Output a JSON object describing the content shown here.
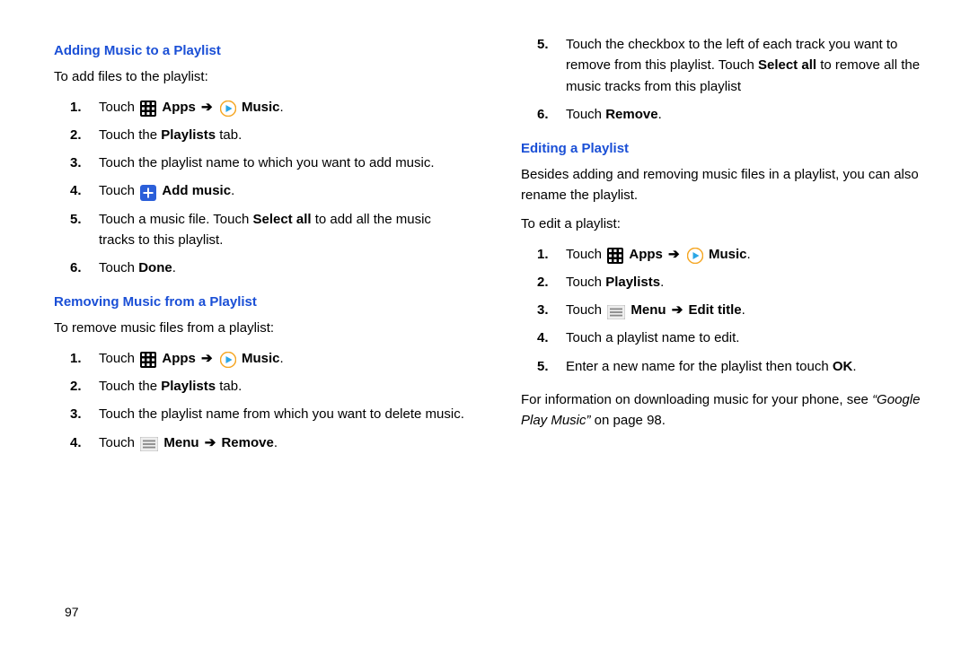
{
  "page_number": "97",
  "arrow_glyph": "➔",
  "left": {
    "heading1": "Adding Music to a Playlist",
    "intro1": "To add files to the playlist:",
    "steps1": [
      {
        "n": "1.",
        "pre": "Touch ",
        "icon": "apps",
        "b1": "Apps",
        "arrow": true,
        "icon2": "music",
        "b2": "Music",
        "post": "."
      },
      {
        "n": "2.",
        "pre": "Touch the ",
        "b1": "Playlists",
        "post": " tab."
      },
      {
        "n": "3.",
        "pre": "Touch the playlist name to which you want to add music."
      },
      {
        "n": "4.",
        "pre": "Touch ",
        "icon": "plus",
        "b1": "Add music",
        "post": "."
      },
      {
        "n": "5.",
        "pre": "Touch a music file. Touch ",
        "b1": "Select all",
        "post": " to add all the music tracks to this playlist."
      },
      {
        "n": "6.",
        "pre": "Touch ",
        "b1": "Done",
        "post": "."
      }
    ],
    "heading2": "Removing Music from a Playlist",
    "intro2": "To remove music files from a playlist:",
    "steps2": [
      {
        "n": "1.",
        "pre": "Touch ",
        "icon": "apps",
        "b1": "Apps",
        "arrow": true,
        "icon2": "music",
        "b2": "Music",
        "post": "."
      },
      {
        "n": "2.",
        "pre": "Touch the ",
        "b1": "Playlists",
        "post": " tab."
      },
      {
        "n": "3.",
        "pre": "Touch the playlist name from which you want to delete music."
      },
      {
        "n": "4.",
        "pre": "Touch ",
        "icon": "menu",
        "b1": "Menu",
        "arrow": true,
        "b2": "Remove",
        "post": "."
      }
    ]
  },
  "right": {
    "continuation_start": "5",
    "steps0": [
      {
        "n": "5.",
        "pre": "Touch the checkbox to the left of each track you want to remove from this playlist. Touch ",
        "b1": "Select all",
        "post": " to remove all the music tracks from this playlist"
      },
      {
        "n": "6.",
        "pre": "Touch ",
        "b1": "Remove",
        "post": "."
      }
    ],
    "heading1": "Editing a Playlist",
    "intro_body": "Besides adding and removing music files in a playlist, you can also rename the playlist.",
    "intro1": "To edit a playlist:",
    "steps1": [
      {
        "n": "1.",
        "pre": "Touch ",
        "icon": "apps",
        "b1": "Apps",
        "arrow": true,
        "icon2": "music",
        "b2": "Music",
        "post": "."
      },
      {
        "n": "2.",
        "pre": "Touch ",
        "b1": "Playlists",
        "post": "."
      },
      {
        "n": "3.",
        "pre": "Touch ",
        "icon": "menu",
        "b1": "Menu",
        "arrow": true,
        "b2": "Edit title",
        "post": "."
      },
      {
        "n": "4.",
        "pre": "Touch a playlist name to edit."
      },
      {
        "n": "5.",
        "pre": "Enter a new name for the playlist then touch ",
        "b1": "OK",
        "post": "."
      }
    ],
    "closing_pre": "For information on downloading music for your phone, see ",
    "closing_italic": "“Google Play Music”",
    "closing_post": " on page 98."
  },
  "icons": {
    "apps_label": "apps-icon",
    "music_label": "music-icon",
    "plus_label": "plus-icon",
    "menu_label": "menu-icon"
  }
}
